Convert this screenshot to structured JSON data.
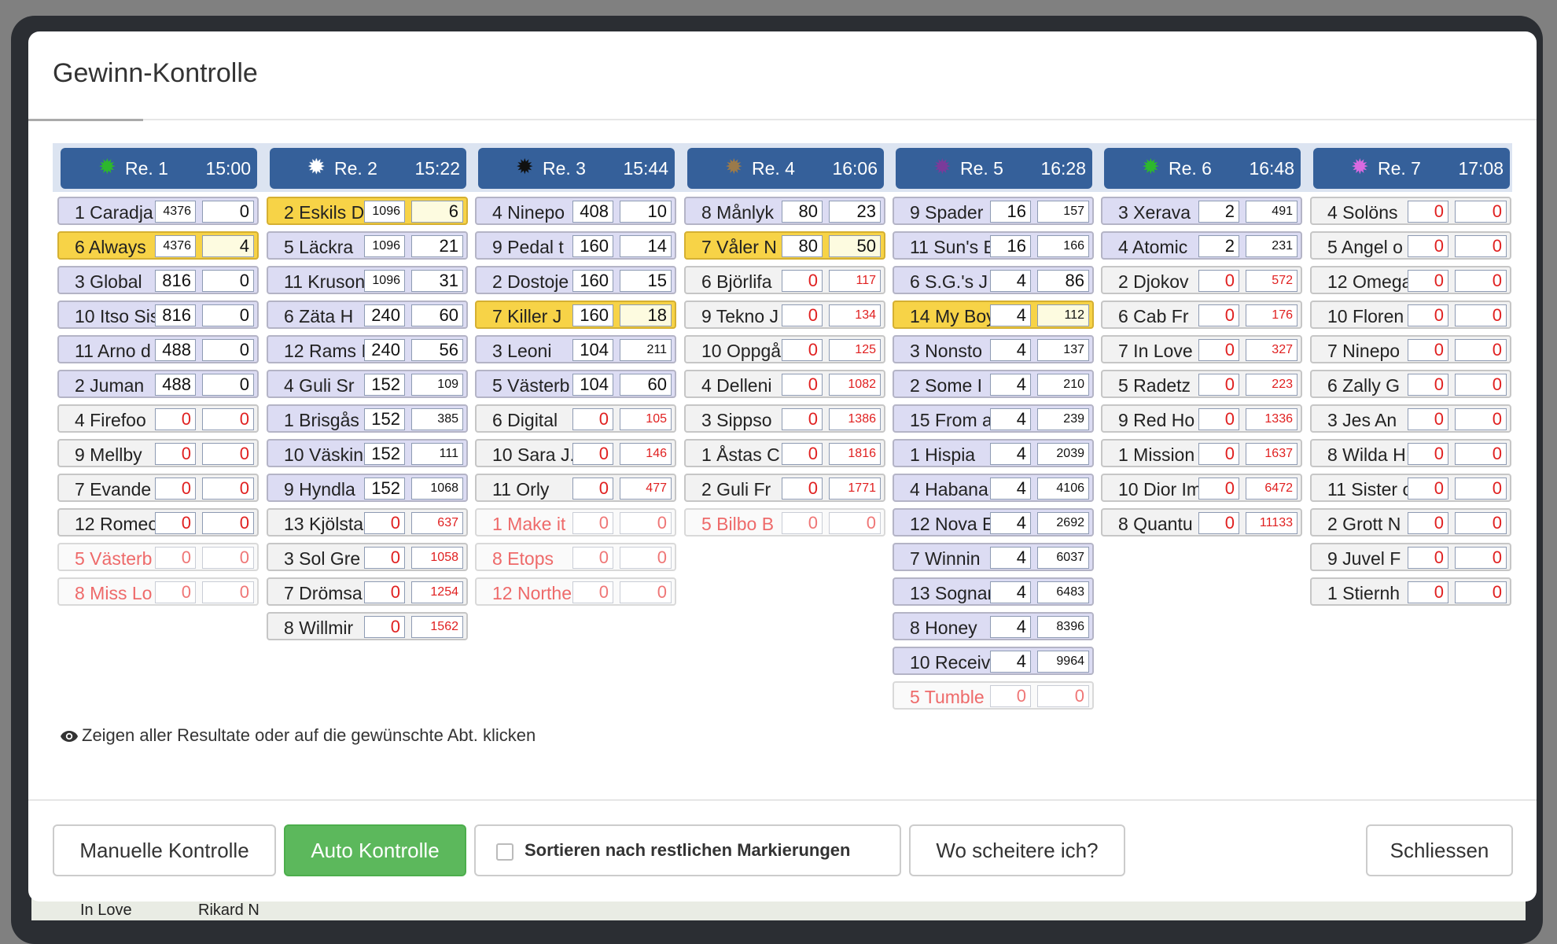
{
  "modal": {
    "title": "Gewinn-Kontrolle"
  },
  "colors": {
    "header": "#35609a",
    "lead": "#f7d347",
    "runner": "#dcdcf3",
    "confirm": "#5cb85c"
  },
  "races": [
    {
      "label": "Re. 1",
      "time": "15:00",
      "star_color": "#2db82d",
      "runners": [
        {
          "name": "1 Caradja",
          "v1": "4376",
          "v2": "0",
          "status": "normal"
        },
        {
          "name": "6 Always",
          "v1": "4376",
          "v2": "4",
          "status": "lead"
        },
        {
          "name": "3 Global",
          "v1": "816",
          "v2": "0",
          "status": "normal"
        },
        {
          "name": "10 Itso Sis",
          "v1": "816",
          "v2": "0",
          "status": "normal"
        },
        {
          "name": "11 Arno d",
          "v1": "488",
          "v2": "0",
          "status": "normal"
        },
        {
          "name": "2 Juman",
          "v1": "488",
          "v2": "0",
          "status": "normal"
        },
        {
          "name": "4 Firefoo",
          "v1": "0",
          "v2": "0",
          "status": "plain"
        },
        {
          "name": "9 Mellby",
          "v1": "0",
          "v2": "0",
          "status": "plain"
        },
        {
          "name": "7 Evande",
          "v1": "0",
          "v2": "0",
          "status": "plain"
        },
        {
          "name": "12 Romeo",
          "v1": "0",
          "v2": "0",
          "status": "plain"
        },
        {
          "name": "5 Västerb",
          "v1": "0",
          "v2": "0",
          "status": "scratched"
        },
        {
          "name": "8 Miss Lo",
          "v1": "0",
          "v2": "0",
          "status": "scratched"
        }
      ]
    },
    {
      "label": "Re. 2",
      "time": "15:22",
      "star_color": "#ffffff",
      "runners": [
        {
          "name": "2 Eskils D",
          "v1": "1096",
          "v2": "6",
          "status": "lead"
        },
        {
          "name": "5 Läckra",
          "v1": "1096",
          "v2": "21",
          "status": "normal"
        },
        {
          "name": "11 Kruson",
          "v1": "1096",
          "v2": "31",
          "status": "normal"
        },
        {
          "name": "6 Zäta H",
          "v1": "240",
          "v2": "60",
          "status": "normal"
        },
        {
          "name": "12 Rams I",
          "v1": "240",
          "v2": "56",
          "status": "normal"
        },
        {
          "name": "4 Guli Sr",
          "v1": "152",
          "v2": "109",
          "status": "normal"
        },
        {
          "name": "1 Brisgås",
          "v1": "152",
          "v2": "385",
          "status": "normal"
        },
        {
          "name": "10 Väsking",
          "v1": "152",
          "v2": "111",
          "status": "normal"
        },
        {
          "name": "9 Hyndla",
          "v1": "152",
          "v2": "1068",
          "status": "normal"
        },
        {
          "name": "13 Kjölsta",
          "v1": "0",
          "v2": "637",
          "status": "plain"
        },
        {
          "name": "3 Sol Gre",
          "v1": "0",
          "v2": "1058",
          "status": "plain"
        },
        {
          "name": "7 Drömsa",
          "v1": "0",
          "v2": "1254",
          "status": "plain"
        },
        {
          "name": "8 Willmir",
          "v1": "0",
          "v2": "1562",
          "status": "plain"
        }
      ]
    },
    {
      "label": "Re. 3",
      "time": "15:44",
      "star_color": "#111111",
      "runners": [
        {
          "name": "4 Ninepo",
          "v1": "408",
          "v2": "10",
          "status": "normal"
        },
        {
          "name": "9 Pedal t",
          "v1": "160",
          "v2": "14",
          "status": "normal"
        },
        {
          "name": "2 Dostoje",
          "v1": "160",
          "v2": "15",
          "status": "normal"
        },
        {
          "name": "7 Killer J",
          "v1": "160",
          "v2": "18",
          "status": "lead"
        },
        {
          "name": "3 Leoni",
          "v1": "104",
          "v2": "211",
          "status": "normal"
        },
        {
          "name": "5 Västerb",
          "v1": "104",
          "v2": "60",
          "status": "normal"
        },
        {
          "name": "6 Digital",
          "v1": "0",
          "v2": "105",
          "status": "plain"
        },
        {
          "name": "10 Sara J.",
          "v1": "0",
          "v2": "146",
          "status": "plain"
        },
        {
          "name": "11 Orly",
          "v1": "0",
          "v2": "477",
          "status": "plain"
        },
        {
          "name": "1 Make it",
          "v1": "0",
          "v2": "0",
          "status": "scratched"
        },
        {
          "name": "8 Etops",
          "v1": "0",
          "v2": "0",
          "status": "scratched"
        },
        {
          "name": "12 Northe",
          "v1": "0",
          "v2": "0",
          "status": "scratched"
        }
      ]
    },
    {
      "label": "Re. 4",
      "time": "16:06",
      "star_color": "#9b7a4a",
      "runners": [
        {
          "name": "8 Månlyk",
          "v1": "80",
          "v2": "23",
          "status": "normal"
        },
        {
          "name": "7 Våler N",
          "v1": "80",
          "v2": "50",
          "status": "lead"
        },
        {
          "name": "6 Björlifa",
          "v1": "0",
          "v2": "117",
          "status": "plain"
        },
        {
          "name": "9 Tekno J",
          "v1": "0",
          "v2": "134",
          "status": "plain"
        },
        {
          "name": "10 Oppgå",
          "v1": "0",
          "v2": "125",
          "status": "plain"
        },
        {
          "name": "4 Delleni",
          "v1": "0",
          "v2": "1082",
          "status": "plain"
        },
        {
          "name": "3 Sippso",
          "v1": "0",
          "v2": "1386",
          "status": "plain"
        },
        {
          "name": "1 Åstas C",
          "v1": "0",
          "v2": "1816",
          "status": "plain"
        },
        {
          "name": "2 Guli Fr",
          "v1": "0",
          "v2": "1771",
          "status": "plain"
        },
        {
          "name": "5 Bilbo B",
          "v1": "0",
          "v2": "0",
          "status": "scratched"
        }
      ]
    },
    {
      "label": "Re. 5",
      "time": "16:28",
      "star_color": "#7a3b9a",
      "runners": [
        {
          "name": "9 Spader",
          "v1": "16",
          "v2": "157",
          "status": "normal"
        },
        {
          "name": "11 Sun's B",
          "v1": "16",
          "v2": "166",
          "status": "normal"
        },
        {
          "name": "6 S.G.'s J",
          "v1": "4",
          "v2": "86",
          "status": "normal"
        },
        {
          "name": "14 My Boy",
          "v1": "4",
          "v2": "112",
          "status": "lead"
        },
        {
          "name": "3 Nonsto",
          "v1": "4",
          "v2": "137",
          "status": "normal"
        },
        {
          "name": "2 Some I",
          "v1": "4",
          "v2": "210",
          "status": "normal"
        },
        {
          "name": "15 From a",
          "v1": "4",
          "v2": "239",
          "status": "normal"
        },
        {
          "name": "1 Hispia",
          "v1": "4",
          "v2": "2039",
          "status": "normal"
        },
        {
          "name": "4 Habana",
          "v1": "4",
          "v2": "4106",
          "status": "normal"
        },
        {
          "name": "12 Nova E",
          "v1": "4",
          "v2": "2692",
          "status": "normal"
        },
        {
          "name": "7 Winnin",
          "v1": "4",
          "v2": "6037",
          "status": "normal"
        },
        {
          "name": "13 Sognar",
          "v1": "4",
          "v2": "6483",
          "status": "normal"
        },
        {
          "name": "8 Honey",
          "v1": "4",
          "v2": "8396",
          "status": "normal"
        },
        {
          "name": "10 Receiv",
          "v1": "4",
          "v2": "9964",
          "status": "normal"
        },
        {
          "name": "5 Tumble",
          "v1": "0",
          "v2": "0",
          "status": "scratched"
        }
      ]
    },
    {
      "label": "Re. 6",
      "time": "16:48",
      "star_color": "#2db82d",
      "runners": [
        {
          "name": "3 Xerava",
          "v1": "2",
          "v2": "491",
          "status": "normal"
        },
        {
          "name": "4 Atomic",
          "v1": "2",
          "v2": "231",
          "status": "normal"
        },
        {
          "name": "2 Djokov",
          "v1": "0",
          "v2": "572",
          "status": "plain"
        },
        {
          "name": "6 Cab Fr",
          "v1": "0",
          "v2": "176",
          "status": "plain"
        },
        {
          "name": "7 In Love",
          "v1": "0",
          "v2": "327",
          "status": "plain"
        },
        {
          "name": "5 Radetz",
          "v1": "0",
          "v2": "223",
          "status": "plain"
        },
        {
          "name": "9 Red Ho",
          "v1": "0",
          "v2": "1336",
          "status": "plain"
        },
        {
          "name": "1 Mission",
          "v1": "0",
          "v2": "1637",
          "status": "plain"
        },
        {
          "name": "10 Dior Im",
          "v1": "0",
          "v2": "6472",
          "status": "plain"
        },
        {
          "name": "8 Quantu",
          "v1": "0",
          "v2": "11133",
          "status": "plain"
        }
      ]
    },
    {
      "label": "Re. 7",
      "time": "17:08",
      "star_color": "#d96ae0",
      "runners": [
        {
          "name": "4 Solöns",
          "v1": "0",
          "v2": "0",
          "status": "plain"
        },
        {
          "name": "5 Angel o",
          "v1": "0",
          "v2": "0",
          "status": "plain"
        },
        {
          "name": "12 Omega",
          "v1": "0",
          "v2": "0",
          "status": "plain"
        },
        {
          "name": "10 Floren",
          "v1": "0",
          "v2": "0",
          "status": "plain"
        },
        {
          "name": "7 Ninepo",
          "v1": "0",
          "v2": "0",
          "status": "plain"
        },
        {
          "name": "6 Zally G",
          "v1": "0",
          "v2": "0",
          "status": "plain"
        },
        {
          "name": "3 Jes An",
          "v1": "0",
          "v2": "0",
          "status": "plain"
        },
        {
          "name": "8 Wilda H",
          "v1": "0",
          "v2": "0",
          "status": "plain"
        },
        {
          "name": "11 Sister o",
          "v1": "0",
          "v2": "0",
          "status": "plain"
        },
        {
          "name": "2 Grott N",
          "v1": "0",
          "v2": "0",
          "status": "plain"
        },
        {
          "name": "9 Juvel F",
          "v1": "0",
          "v2": "0",
          "status": "plain"
        },
        {
          "name": "1 Stiernh",
          "v1": "0",
          "v2": "0",
          "status": "plain"
        }
      ]
    }
  ],
  "hint": {
    "text": "Zeigen aller Resultate oder auf die gewünschte Abt. klicken",
    "icon": "eye-icon"
  },
  "footer": {
    "manual_label": "Manuelle Kontrolle",
    "auto_label": "Auto Kontrolle",
    "sort_label": "Sortieren nach restlichen Markierungen",
    "fail_label": "Wo scheitere ich?",
    "close_label": "Schliessen"
  },
  "background": {
    "row_left": "In Love",
    "row_right": "Rikard N"
  }
}
